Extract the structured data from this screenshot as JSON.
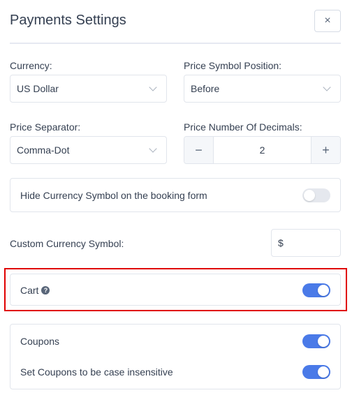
{
  "header": {
    "title": "Payments Settings",
    "close_glyph": "×"
  },
  "currency": {
    "label": "Currency:",
    "value": "US Dollar"
  },
  "symbol_position": {
    "label": "Price Symbol Position:",
    "value": "Before"
  },
  "separator": {
    "label": "Price Separator:",
    "value": "Comma-Dot"
  },
  "decimals": {
    "label": "Price Number Of Decimals:",
    "value": "2",
    "minus_glyph": "−",
    "plus_glyph": "+"
  },
  "hide_symbol": {
    "label": "Hide Currency Symbol on the booking form",
    "enabled": false
  },
  "custom_symbol": {
    "label": "Custom Currency Symbol:",
    "value": "$"
  },
  "cart": {
    "label": "Cart",
    "help_glyph": "?",
    "enabled": true
  },
  "coupons": {
    "label": "Coupons",
    "enabled": true
  },
  "coupons_case": {
    "label": "Set Coupons to be case insensitive",
    "enabled": true
  },
  "colors": {
    "toggle_on": "#4a7ae8",
    "toggle_off": "#e5e8ee",
    "highlight": "#e00000"
  }
}
